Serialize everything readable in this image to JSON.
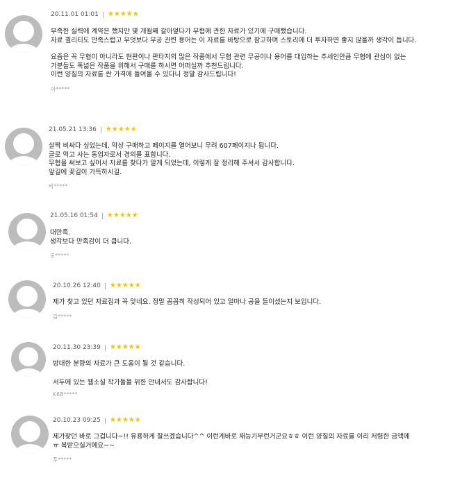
{
  "reviews": [
    {
      "date": "20.11.01 01:01",
      "stars": "★★★★★",
      "lines": [
        "부족한 실력에 계약은 했지만 몇 개월째 갈아엎다가 무협에 관한 자료가 있기에 구매했습니다.",
        "자료 퀄리티도 만족스럽고 무엇보다 무공 관련 용어는 이 자료를 바탕으로 참고하며 스토리에 더 투자하면 좋지 않을까 생각이 듭니다.",
        "",
        "요즘은 꼭 무협이 아니라도 현판이나 판타지의 많은 작품에서 무협 관련 무공이나 용어를 대입하는 추세인만큼 무협에 관심이 없는",
        "가분들도 폭넓은 작품을 위해서 구매를 하시면 어떠실까 추천드립니다.",
        "이런 양질의 자료를 싼 가격에 들여올 수 있다니 정말 감사드립니다!"
      ],
      "author": "아*****"
    },
    {
      "date": "21.05.21 13:36",
      "stars": "★★★★★",
      "lines": [
        "살짝 비싸다 싶었는데, 막상 구매하고 페이지를 열어보니 무려 607페이지나 됩니다.",
        "글로 먹고 사는 동업자로서 경의를 표합니다.",
        "무협을 써보고 싶어서 자료를 찾다가 알게 되었는데, 이렇게 잘 정리해 주셔서 감사합니다.",
        "앞길에 꽃길이 가득하시길."
      ],
      "author": "비*****"
    },
    {
      "date": "21.05.16 01:54",
      "stars": "★★★★★",
      "lines": [
        "대만족.",
        "생각보다 만족감이 더 큽니다."
      ],
      "author": "모*****"
    },
    {
      "date": "20.10.26 12:40",
      "stars": "★★★★★",
      "lines": [
        "제가 찾고 있던 자료집과 꼭 맞네요. 정말 꼼꼼히 작성되어 있고 얼마나 공을 들이셨는지 보입니다."
      ],
      "author": "김*****"
    },
    {
      "date": "20.11.30 23:39",
      "stars": "★★★★★",
      "lines": [
        "방대한 분량의 자료가 큰 도움이 될 것 같습니다.",
        "",
        "서두에 있는 웹소설 작가들을 위한 안내서도 감사합니다!"
      ],
      "author": "K68*****"
    },
    {
      "date": "20.10.23 09:25",
      "stars": "★★★★★",
      "lines": [
        "제가찾던 바로 그겁니다~!! 유용하게 잘쓰겠습니다^^ 이런게바로 재능기부런거군요ㅎㅎ 이런 양질의  자료를 이리 저렴한 금액에",
        "ㅠ 복받으실거에요~~"
      ],
      "author": "푸*****"
    }
  ]
}
